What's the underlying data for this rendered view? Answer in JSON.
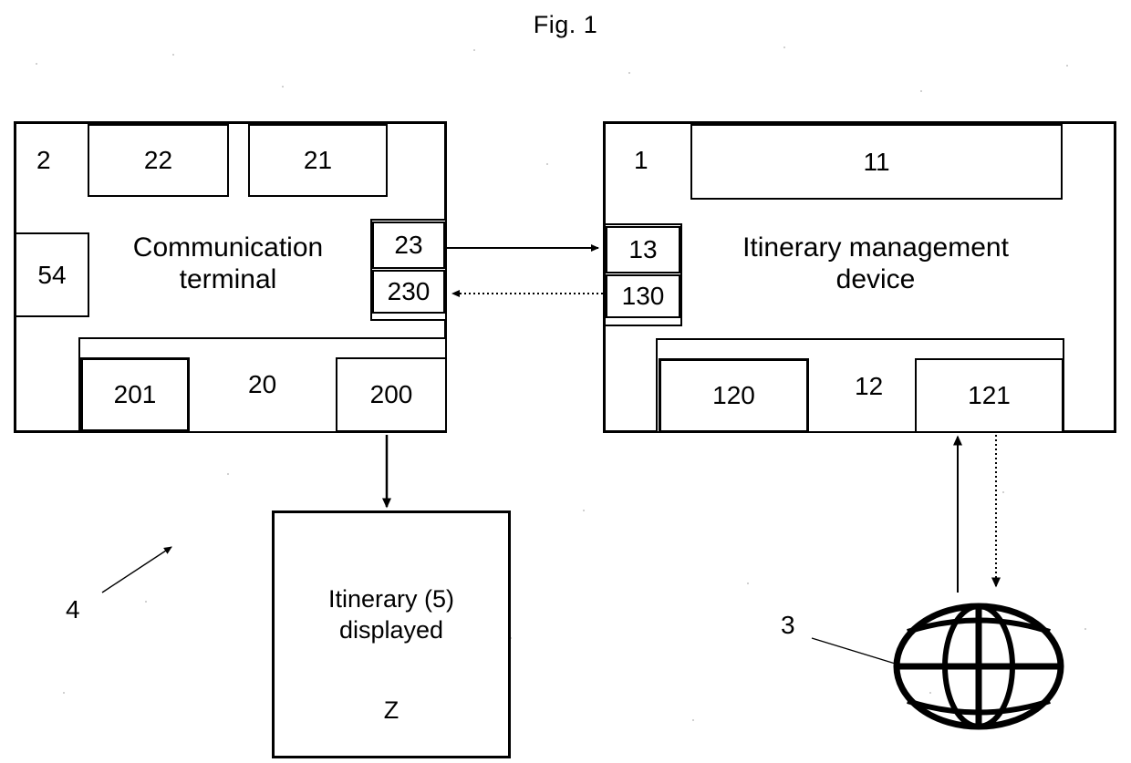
{
  "figure": {
    "title": "Fig. 1",
    "type": "patent-block-diagram"
  },
  "colors": {
    "ink": "#000000",
    "paper": "#ffffff"
  },
  "left_system": {
    "ref": "2",
    "title": "Communication\nterminal",
    "title_line1": "Communication",
    "title_line2": "terminal",
    "top_modules": [
      {
        "ref": "22"
      },
      {
        "ref": "21"
      }
    ],
    "side_module": {
      "ref": "54"
    },
    "interface_group": {
      "upper": {
        "ref": "23"
      },
      "lower": {
        "ref": "230"
      }
    },
    "bottom_group": {
      "ref": "20",
      "children": [
        {
          "ref": "201"
        },
        {
          "ref": "200"
        }
      ]
    }
  },
  "right_system": {
    "ref": "1",
    "title_line1": "Itinerary management",
    "title_line2": "device",
    "top_modules": [
      {
        "ref": "11"
      }
    ],
    "interface_group": {
      "upper": {
        "ref": "13"
      },
      "lower": {
        "ref": "130"
      }
    },
    "bottom_group": {
      "ref": "12",
      "children": [
        {
          "ref": "120"
        },
        {
          "ref": "121"
        }
      ]
    }
  },
  "output_box": {
    "line1": "Itinerary (5)",
    "line2": "displayed",
    "line3": "Z"
  },
  "network": {
    "ref": "3",
    "icon": "globe-icon"
  },
  "system_callout": {
    "ref": "4"
  },
  "connectors": [
    {
      "name": "terminal-to-device-request",
      "from": "23",
      "to": "13",
      "style": "solid",
      "direction": "right"
    },
    {
      "name": "device-to-terminal-response",
      "from": "130",
      "to": "230",
      "style": "dotted",
      "direction": "left"
    },
    {
      "name": "terminal-to-display",
      "from": "200",
      "to": "output_box",
      "style": "solid",
      "direction": "down"
    },
    {
      "name": "network-to-device",
      "from": "3",
      "to": "121",
      "style": "solid",
      "direction": "up"
    },
    {
      "name": "device-to-network",
      "from": "121",
      "to": "3",
      "style": "dotted",
      "direction": "down"
    }
  ]
}
